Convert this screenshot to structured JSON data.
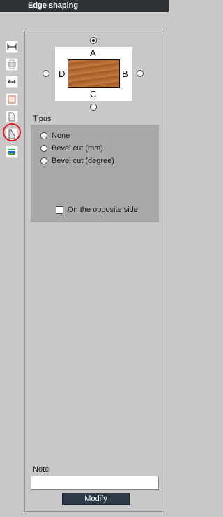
{
  "window": {
    "title": "Edge shaping"
  },
  "toolbar": {
    "tools": [
      {
        "name": "edge-width-tool-icon"
      },
      {
        "name": "panel-stack-tool-icon"
      },
      {
        "name": "edge-length-tool-icon"
      },
      {
        "name": "edge-corner-tool-icon"
      },
      {
        "name": "edge-profile-tool-icon"
      },
      {
        "name": "edge-shaping-tool-icon",
        "selected": true
      },
      {
        "name": "color-layers-tool-icon"
      }
    ],
    "highlight_color": "#e01b22"
  },
  "preview": {
    "sides": {
      "top": "A",
      "right": "B",
      "bottom": "C",
      "left": "D"
    },
    "selected_side": "A",
    "board_color": "#b8703a"
  },
  "type_group": {
    "label": "Tipus",
    "options": [
      {
        "label": "None",
        "selected": false
      },
      {
        "label": "Bevel cut (mm)",
        "selected": false
      },
      {
        "label": "Bevel cut (degree)",
        "selected": false
      }
    ],
    "opposite_side": {
      "label": "On the opposite side",
      "checked": false
    }
  },
  "note": {
    "label": "Note",
    "value": ""
  },
  "actions": {
    "modify_label": "Modify"
  }
}
